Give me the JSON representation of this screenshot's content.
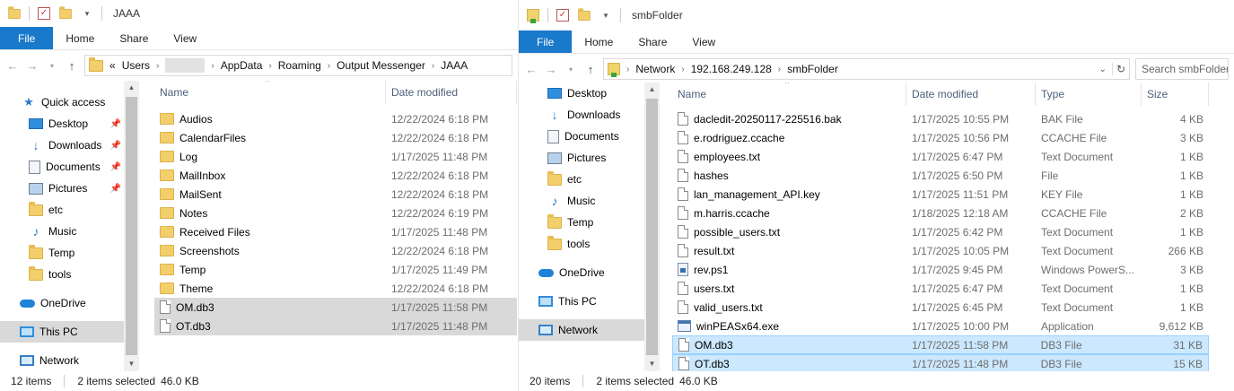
{
  "left": {
    "title": "JAAA",
    "ribbon": [
      "File",
      "Home",
      "Share",
      "View"
    ],
    "address": {
      "overflow": "«",
      "crumbs": [
        "Users",
        "AppData",
        "Roaming",
        "Output Messenger",
        "JAAA"
      ]
    },
    "nav": [
      {
        "label": "Quick access",
        "icon": "star-icon"
      },
      {
        "label": "Desktop",
        "icon": "desktop-icon",
        "pinned": true
      },
      {
        "label": "Downloads",
        "icon": "downloads-icon",
        "pinned": true
      },
      {
        "label": "Documents",
        "icon": "documents-icon",
        "pinned": true
      },
      {
        "label": "Pictures",
        "icon": "pictures-icon",
        "pinned": true
      },
      {
        "label": "etc",
        "icon": "folder-icon"
      },
      {
        "label": "Music",
        "icon": "music-icon"
      },
      {
        "label": "Temp",
        "icon": "folder-icon"
      },
      {
        "label": "tools",
        "icon": "folder-icon"
      },
      {
        "label": "OneDrive",
        "icon": "onedrive-icon"
      },
      {
        "label": "This PC",
        "icon": "this-pc-icon",
        "selected": true
      },
      {
        "label": "Network",
        "icon": "network-icon"
      }
    ],
    "columns": {
      "name": "Name",
      "date": "Date modified"
    },
    "files": [
      {
        "name": "Audios",
        "date": "12/22/2024 6:18 PM",
        "kind": "folder"
      },
      {
        "name": "CalendarFiles",
        "date": "12/22/2024 6:18 PM",
        "kind": "folder"
      },
      {
        "name": "Log",
        "date": "1/17/2025 11:48 PM",
        "kind": "folder"
      },
      {
        "name": "MailInbox",
        "date": "12/22/2024 6:18 PM",
        "kind": "folder"
      },
      {
        "name": "MailSent",
        "date": "12/22/2024 6:18 PM",
        "kind": "folder"
      },
      {
        "name": "Notes",
        "date": "12/22/2024 6:19 PM",
        "kind": "folder"
      },
      {
        "name": "Received Files",
        "date": "1/17/2025 11:48 PM",
        "kind": "folder"
      },
      {
        "name": "Screenshots",
        "date": "12/22/2024 6:18 PM",
        "kind": "folder"
      },
      {
        "name": "Temp",
        "date": "1/17/2025 11:49 PM",
        "kind": "folder"
      },
      {
        "name": "Theme",
        "date": "12/22/2024 6:18 PM",
        "kind": "folder"
      },
      {
        "name": "OM.db3",
        "date": "1/17/2025 11:58 PM",
        "kind": "file",
        "selected": true
      },
      {
        "name": "OT.db3",
        "date": "1/17/2025 11:48 PM",
        "kind": "file",
        "selected": true
      }
    ],
    "status": {
      "count": "12 items",
      "selected": "2 items selected",
      "size": "46.0 KB"
    }
  },
  "right": {
    "title": "smbFolder",
    "ribbon": [
      "File",
      "Home",
      "Share",
      "View"
    ],
    "address": {
      "crumbs": [
        "Network",
        "192.168.249.128",
        "smbFolder"
      ]
    },
    "search_placeholder": "Search smbFolder",
    "nav": [
      {
        "label": "Desktop",
        "icon": "desktop-icon",
        "pinned": true
      },
      {
        "label": "Downloads",
        "icon": "downloads-icon",
        "pinned": true
      },
      {
        "label": "Documents",
        "icon": "documents-icon",
        "pinned": true
      },
      {
        "label": "Pictures",
        "icon": "pictures-icon",
        "pinned": true
      },
      {
        "label": "etc",
        "icon": "folder-icon"
      },
      {
        "label": "Music",
        "icon": "music-icon"
      },
      {
        "label": "Temp",
        "icon": "folder-icon"
      },
      {
        "label": "tools",
        "icon": "folder-icon"
      },
      {
        "label": "OneDrive",
        "icon": "onedrive-icon"
      },
      {
        "label": "This PC",
        "icon": "this-pc-icon"
      },
      {
        "label": "Network",
        "icon": "network-icon",
        "selected": true
      }
    ],
    "columns": {
      "name": "Name",
      "date": "Date modified",
      "type": "Type",
      "size": "Size"
    },
    "files": [
      {
        "name": "dacledit-20250117-225516.bak",
        "date": "1/17/2025 10:55 PM",
        "type": "BAK File",
        "size": "4 KB",
        "kind": "file"
      },
      {
        "name": "e.rodriguez.ccache",
        "date": "1/17/2025 10:56 PM",
        "type": "CCACHE File",
        "size": "3 KB",
        "kind": "file"
      },
      {
        "name": "employees.txt",
        "date": "1/17/2025 6:47 PM",
        "type": "Text Document",
        "size": "1 KB",
        "kind": "file"
      },
      {
        "name": "hashes",
        "date": "1/17/2025 6:50 PM",
        "type": "File",
        "size": "1 KB",
        "kind": "file"
      },
      {
        "name": "lan_management_API.key",
        "date": "1/17/2025 11:51 PM",
        "type": "KEY File",
        "size": "1 KB",
        "kind": "file"
      },
      {
        "name": "m.harris.ccache",
        "date": "1/18/2025 12:18 AM",
        "type": "CCACHE File",
        "size": "2 KB",
        "kind": "file"
      },
      {
        "name": "possible_users.txt",
        "date": "1/17/2025 6:42 PM",
        "type": "Text Document",
        "size": "1 KB",
        "kind": "file"
      },
      {
        "name": "result.txt",
        "date": "1/17/2025 10:05 PM",
        "type": "Text Document",
        "size": "266 KB",
        "kind": "file"
      },
      {
        "name": "rev.ps1",
        "date": "1/17/2025 9:45 PM",
        "type": "Windows PowerS...",
        "size": "3 KB",
        "kind": "ps1"
      },
      {
        "name": "users.txt",
        "date": "1/17/2025 6:47 PM",
        "type": "Text Document",
        "size": "1 KB",
        "kind": "file"
      },
      {
        "name": "valid_users.txt",
        "date": "1/17/2025 6:45 PM",
        "type": "Text Document",
        "size": "1 KB",
        "kind": "file"
      },
      {
        "name": "winPEASx64.exe",
        "date": "1/17/2025 10:00 PM",
        "type": "Application",
        "size": "9,612 KB",
        "kind": "exe"
      },
      {
        "name": "OM.db3",
        "date": "1/17/2025 11:58 PM",
        "type": "DB3 File",
        "size": "31 KB",
        "kind": "file",
        "selected": true
      },
      {
        "name": "OT.db3",
        "date": "1/17/2025 11:48 PM",
        "type": "DB3 File",
        "size": "15 KB",
        "kind": "file",
        "selected": true
      }
    ],
    "status": {
      "count": "20 items",
      "selected": "2 items selected",
      "size": "46.0 KB"
    }
  },
  "colors": {
    "accent": "#1979ca",
    "selection_blue": "#cce8ff",
    "selection_gray": "#d9d9d9",
    "header_text": "#4c607a"
  }
}
